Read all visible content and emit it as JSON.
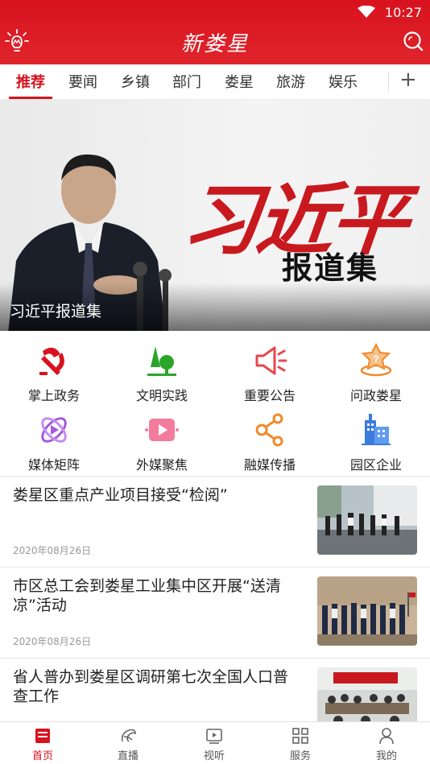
{
  "status_bar": {
    "time": "10:27"
  },
  "header": {
    "title": "新娄星"
  },
  "tabs": {
    "items": [
      {
        "label": "推荐",
        "active": true
      },
      {
        "label": "要闻"
      },
      {
        "label": "乡镇"
      },
      {
        "label": "部门"
      },
      {
        "label": "娄星"
      },
      {
        "label": "旅游"
      },
      {
        "label": "娱乐"
      }
    ],
    "add_label": "+"
  },
  "banner": {
    "headline_art": "习近平",
    "sub_art": "报道集",
    "caption": "习近平报道集"
  },
  "shortcuts": [
    {
      "label": "掌上政务",
      "icon": "party-emblem-icon"
    },
    {
      "label": "文明实践",
      "icon": "tree-icon"
    },
    {
      "label": "重要公告",
      "icon": "megaphone-icon"
    },
    {
      "label": "问政娄星",
      "icon": "question-star-icon"
    },
    {
      "label": "媒体矩阵",
      "icon": "orbit-icon"
    },
    {
      "label": "外媒聚焦",
      "icon": "video-play-icon"
    },
    {
      "label": "融媒传播",
      "icon": "share-nodes-icon"
    },
    {
      "label": "园区企业",
      "icon": "building-icon"
    }
  ],
  "news": [
    {
      "title": "娄星区重点产业项目接受“检阅”",
      "date": "2020年08月26日"
    },
    {
      "title": "市区总工会到娄星工业集中区开展“送清凉”活动",
      "date": "2020年08月26日"
    },
    {
      "title": "省人普办到娄星区调研第七次全国人口普查工作",
      "date": ""
    }
  ],
  "bottom_nav": [
    {
      "label": "首页",
      "active": true
    },
    {
      "label": "直播"
    },
    {
      "label": "视听"
    },
    {
      "label": "服务"
    },
    {
      "label": "我的"
    }
  ],
  "colors": {
    "brand_red": "#d8121e",
    "accent_orange": "#f08a2b",
    "accent_purple": "#a35bd9",
    "accent_green": "#2aa52a",
    "accent_blue": "#3b7bdc"
  }
}
